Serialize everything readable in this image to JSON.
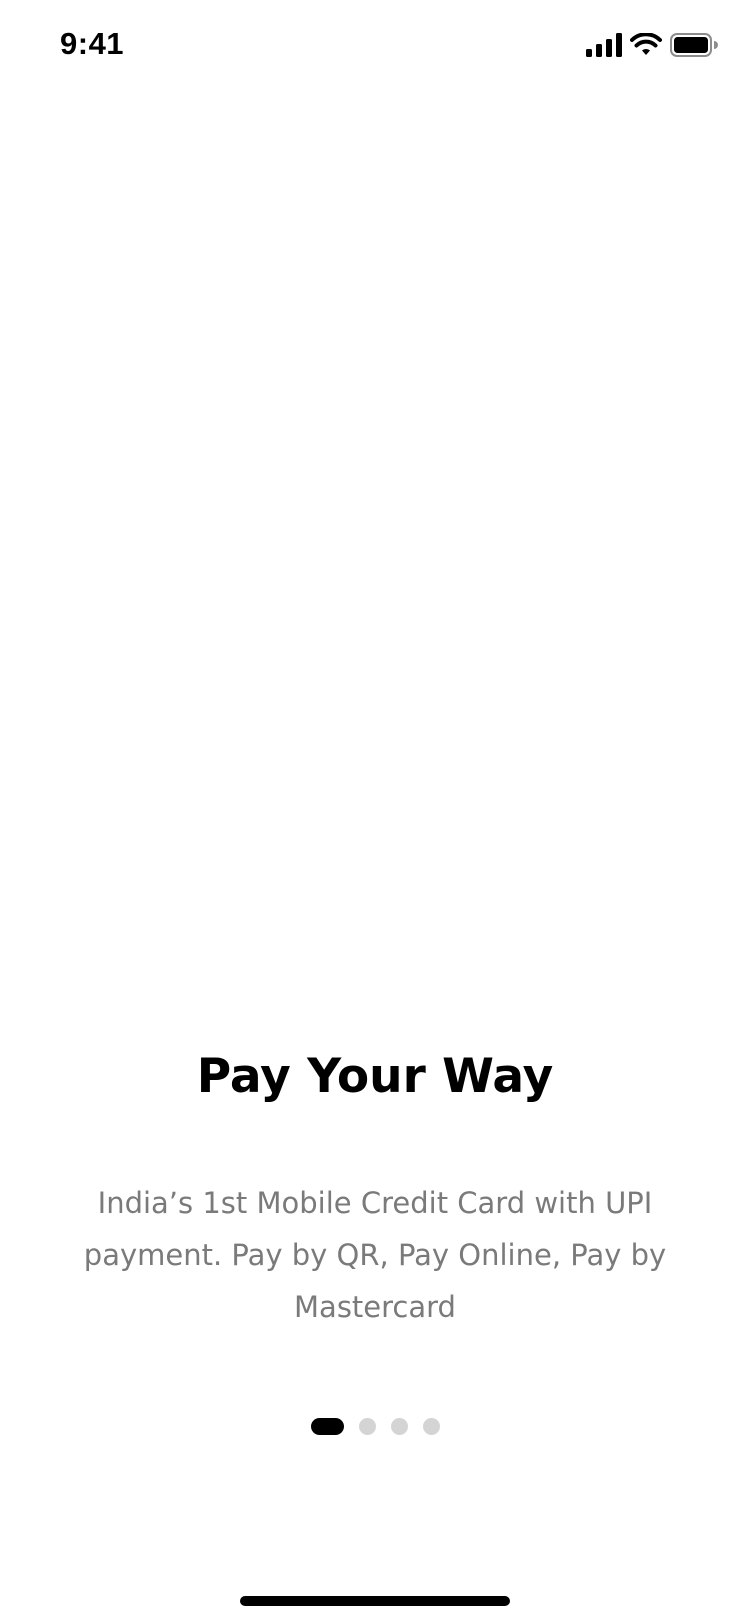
{
  "status_bar": {
    "time": "9:41",
    "icons": [
      "signal-icon",
      "wifi-icon",
      "battery-icon"
    ]
  },
  "onboarding": {
    "title": "Pay Your Way",
    "description": "India’s 1st Mobile Credit Card with UPI payment. Pay by QR, Pay Online, Pay by Mastercard",
    "pager": {
      "total_pages": 4,
      "current_page": 1
    }
  },
  "colors": {
    "title": "#000000",
    "description": "#7a7a7a",
    "dot_active": "#000000",
    "dot_inactive": "#d4d4d4"
  }
}
